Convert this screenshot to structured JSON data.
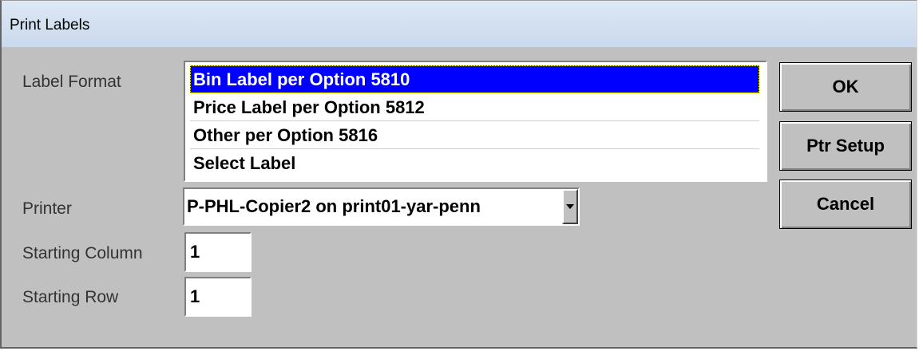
{
  "window": {
    "title": "Print Labels"
  },
  "label_format": {
    "label": "Label Format",
    "items": [
      "Bin Label per Option 5810",
      "Price Label per Option 5812",
      "Other per Option 5816",
      "Select Label"
    ],
    "selected": "Bin Label per Option 5810"
  },
  "printer": {
    "label": "Printer",
    "value": "P-PHL-Copier2 on print01-yar-penn"
  },
  "starting_column": {
    "label": "Starting Column",
    "value": "1"
  },
  "starting_row": {
    "label": "Starting Row",
    "value": "1"
  },
  "buttons": {
    "ok": "OK",
    "ptr_setup": "Ptr Setup",
    "cancel": "Cancel"
  },
  "colors": {
    "dialog_bg": "#c0c0c0",
    "selection_bg": "#0000ff",
    "titlebar_bg": "#d4e0ef"
  }
}
